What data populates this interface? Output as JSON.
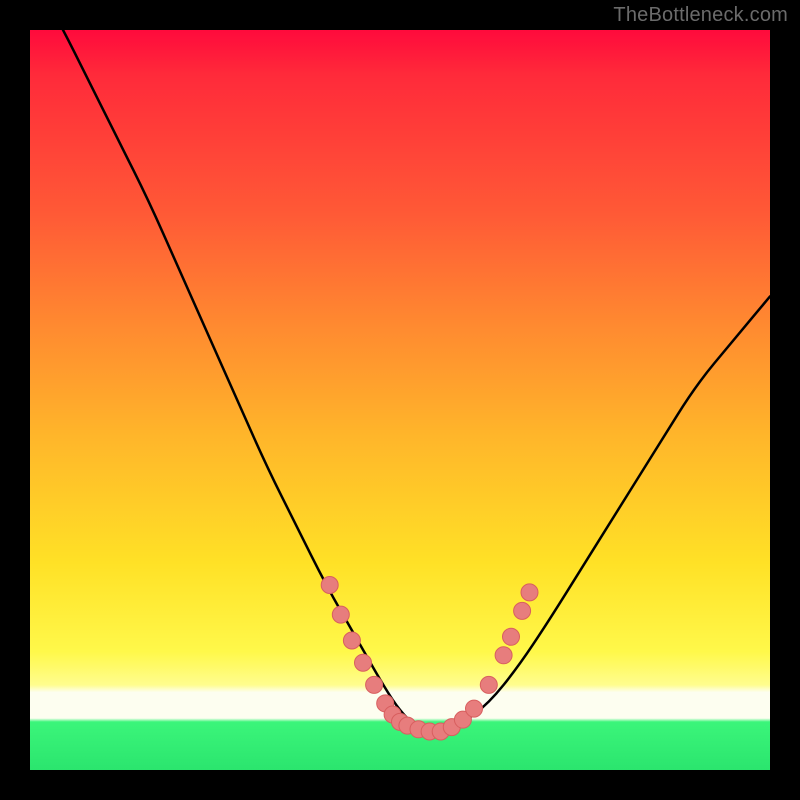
{
  "watermark": {
    "text": "TheBottleneck.com"
  },
  "chart_data": {
    "type": "line",
    "title": "",
    "xlabel": "",
    "ylabel": "",
    "xlim": [
      0,
      100
    ],
    "ylim": [
      0,
      100
    ],
    "grid": false,
    "legend": false,
    "series": [
      {
        "name": "bottleneck-curve",
        "x": [
          0,
          4,
          8,
          12,
          16,
          20,
          24,
          28,
          32,
          36,
          40,
          44,
          48,
          50,
          52,
          55,
          58,
          62,
          66,
          70,
          75,
          80,
          85,
          90,
          95,
          100
        ],
        "y": [
          108,
          101,
          93,
          85,
          77,
          68,
          59,
          50,
          41,
          33,
          25,
          18,
          11,
          8,
          6,
          5,
          6,
          9,
          14,
          20,
          28,
          36,
          44,
          52,
          58,
          64
        ]
      }
    ],
    "markers": [
      {
        "name": "dot",
        "x": 40.5,
        "y": 25.0
      },
      {
        "name": "dot",
        "x": 42.0,
        "y": 21.0
      },
      {
        "name": "dot",
        "x": 43.5,
        "y": 17.5
      },
      {
        "name": "dot",
        "x": 45.0,
        "y": 14.5
      },
      {
        "name": "dot",
        "x": 46.5,
        "y": 11.5
      },
      {
        "name": "dot",
        "x": 48.0,
        "y": 9.0
      },
      {
        "name": "dot",
        "x": 49.0,
        "y": 7.5
      },
      {
        "name": "dot",
        "x": 50.0,
        "y": 6.5
      },
      {
        "name": "dot",
        "x": 51.0,
        "y": 6.0
      },
      {
        "name": "dot",
        "x": 52.5,
        "y": 5.5
      },
      {
        "name": "dot",
        "x": 54.0,
        "y": 5.2
      },
      {
        "name": "dot",
        "x": 55.5,
        "y": 5.2
      },
      {
        "name": "dot",
        "x": 57.0,
        "y": 5.8
      },
      {
        "name": "dot",
        "x": 58.5,
        "y": 6.8
      },
      {
        "name": "dot",
        "x": 60.0,
        "y": 8.3
      },
      {
        "name": "dot",
        "x": 62.0,
        "y": 11.5
      },
      {
        "name": "dot",
        "x": 64.0,
        "y": 15.5
      },
      {
        "name": "dot",
        "x": 65.0,
        "y": 18.0
      },
      {
        "name": "dot",
        "x": 66.5,
        "y": 21.5
      },
      {
        "name": "dot",
        "x": 67.5,
        "y": 24.0
      }
    ],
    "colors": {
      "curve": "#000000",
      "marker_fill": "#e77d7d",
      "marker_stroke": "#d85f5f",
      "gradient_top": "#ff0a3c",
      "gradient_mid": "#ffe126",
      "gradient_pale": "#fdfef0",
      "gradient_bottom": "#2be56e"
    }
  }
}
